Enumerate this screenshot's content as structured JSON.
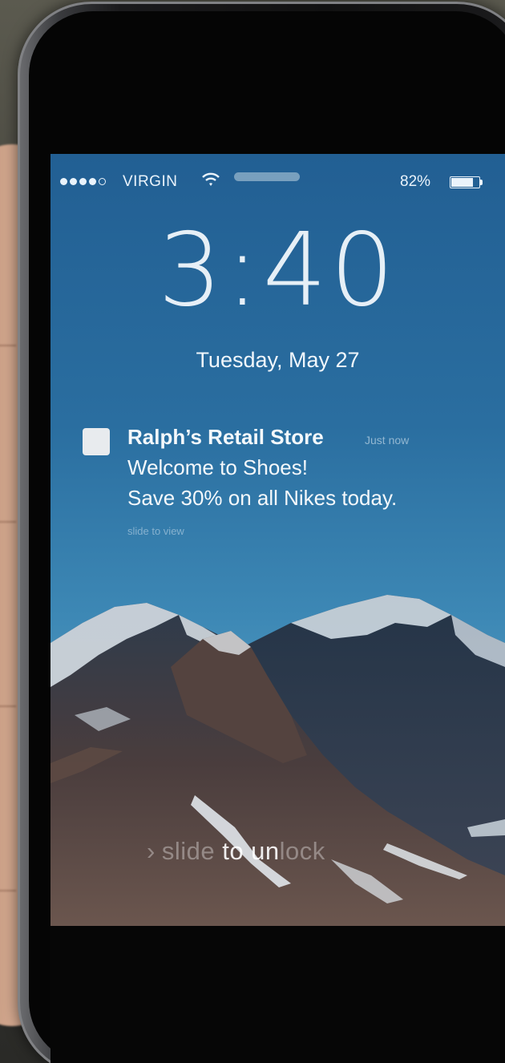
{
  "status_bar": {
    "signal_strength": "4 of 5",
    "carrier": "VIRGIN",
    "wifi_icon": "wifi-icon",
    "battery_percent_label": "82%",
    "battery_level": 0.82
  },
  "lock_screen": {
    "time": "3:40",
    "date": "Tuesday, May 27",
    "unlock_chevron": "›",
    "unlock_text_a": "slide",
    "unlock_text_b": " to un",
    "unlock_text_c": "lock"
  },
  "notification": {
    "app_icon": "app-icon",
    "app_name": "Ralph’s Retail Store",
    "timestamp": "Just now",
    "line1": "Welcome to Shoes!",
    "line2": "Save 30% on all Nikes today.",
    "action_hint": "slide to view"
  },
  "colors": {
    "sky_top": "#225f93",
    "sky_bottom": "#6aa8c6",
    "text": "#f1f7fc"
  }
}
